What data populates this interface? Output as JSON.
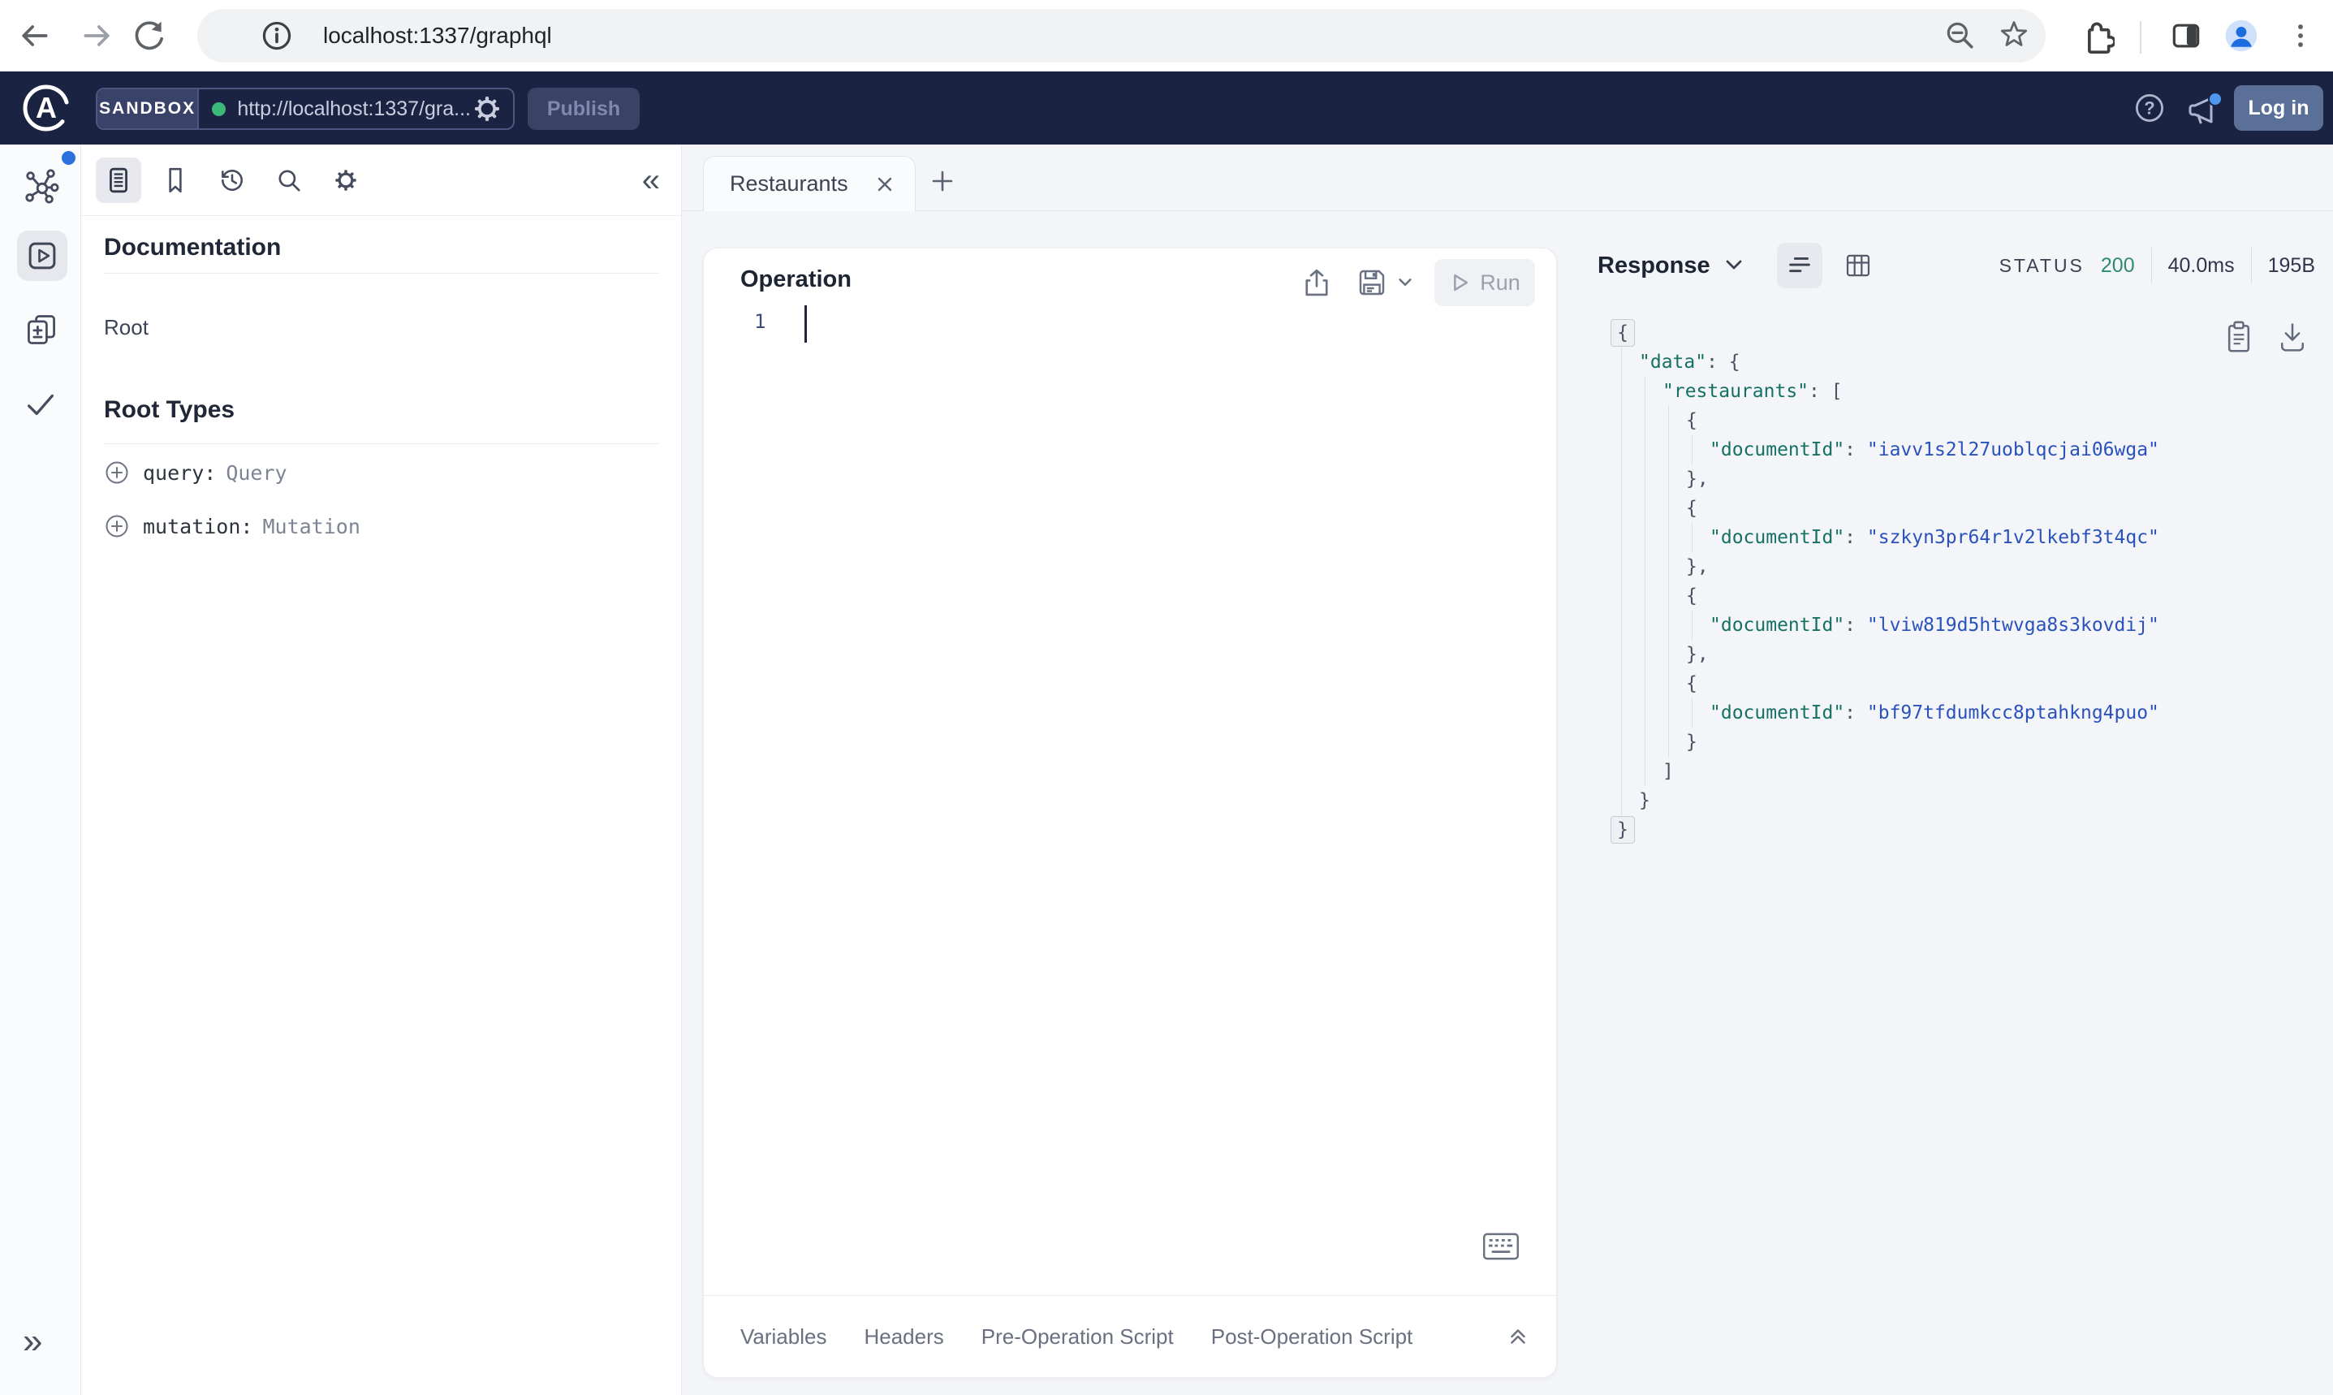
{
  "colors": {
    "header_bg": "#1b2342",
    "accent_green_dot": "#3cb878",
    "status_green": "#2e8a70",
    "json_key": "#157164",
    "json_string": "#2a52bd",
    "notification_blue": "#2b72dd",
    "login_btn": "#5b7099",
    "avatar_blue": "#1b6ce0"
  },
  "icons": {
    "collapse_left": "«",
    "expand_right": "»"
  },
  "browser": {
    "url": "localhost:1337/graphql"
  },
  "header": {
    "logo_letter": "A",
    "sandbox_label": "SANDBOX",
    "endpoint_url": "http://localhost:1337/gra...",
    "publish_label": "Publish",
    "login_label": "Log in"
  },
  "docs": {
    "title": "Documentation",
    "root_item": "Root",
    "root_types_title": "Root Types",
    "types": [
      {
        "field": "query:",
        "type": "Query"
      },
      {
        "field": "mutation:",
        "type": "Mutation"
      }
    ]
  },
  "tabs": {
    "active": "Restaurants"
  },
  "operation": {
    "title": "Operation",
    "run_label": "Run",
    "line_number": "1"
  },
  "response": {
    "title": "Response",
    "status_label": "STATUS",
    "status_code": "200",
    "duration": "40.0ms",
    "size": "195B",
    "lines": [
      {
        "ind": 0,
        "fold": true,
        "t": [
          [
            "p",
            "{"
          ]
        ]
      },
      {
        "ind": 1,
        "t": [
          [
            "k",
            "\"data\""
          ],
          [
            "p",
            ": {"
          ]
        ]
      },
      {
        "ind": 2,
        "t": [
          [
            "k",
            "\"restaurants\""
          ],
          [
            "p",
            ": ["
          ]
        ]
      },
      {
        "ind": 3,
        "t": [
          [
            "p",
            "{"
          ]
        ]
      },
      {
        "ind": 4,
        "t": [
          [
            "k",
            "\"documentId\""
          ],
          [
            "p",
            ": "
          ],
          [
            "s",
            "\"iavv1s2l27uoblqcjai06wga\""
          ]
        ]
      },
      {
        "ind": 3,
        "t": [
          [
            "p",
            "},"
          ]
        ]
      },
      {
        "ind": 3,
        "t": [
          [
            "p",
            "{"
          ]
        ]
      },
      {
        "ind": 4,
        "t": [
          [
            "k",
            "\"documentId\""
          ],
          [
            "p",
            ": "
          ],
          [
            "s",
            "\"szkyn3pr64r1v2lkebf3t4qc\""
          ]
        ]
      },
      {
        "ind": 3,
        "t": [
          [
            "p",
            "},"
          ]
        ]
      },
      {
        "ind": 3,
        "t": [
          [
            "p",
            "{"
          ]
        ]
      },
      {
        "ind": 4,
        "t": [
          [
            "k",
            "\"documentId\""
          ],
          [
            "p",
            ": "
          ],
          [
            "s",
            "\"lviw819d5htwvga8s3kovdij\""
          ]
        ]
      },
      {
        "ind": 3,
        "t": [
          [
            "p",
            "},"
          ]
        ]
      },
      {
        "ind": 3,
        "t": [
          [
            "p",
            "{"
          ]
        ]
      },
      {
        "ind": 4,
        "t": [
          [
            "k",
            "\"documentId\""
          ],
          [
            "p",
            ": "
          ],
          [
            "s",
            "\"bf97tfdumkcc8ptahkng4puo\""
          ]
        ]
      },
      {
        "ind": 3,
        "t": [
          [
            "p",
            "}"
          ]
        ]
      },
      {
        "ind": 2,
        "t": [
          [
            "p",
            "]"
          ]
        ]
      },
      {
        "ind": 1,
        "t": [
          [
            "p",
            "}"
          ]
        ]
      },
      {
        "ind": 0,
        "fold": true,
        "t": [
          [
            "p",
            "}"
          ]
        ]
      }
    ]
  },
  "bottom_tabs": [
    "Variables",
    "Headers",
    "Pre-Operation Script",
    "Post-Operation Script"
  ]
}
